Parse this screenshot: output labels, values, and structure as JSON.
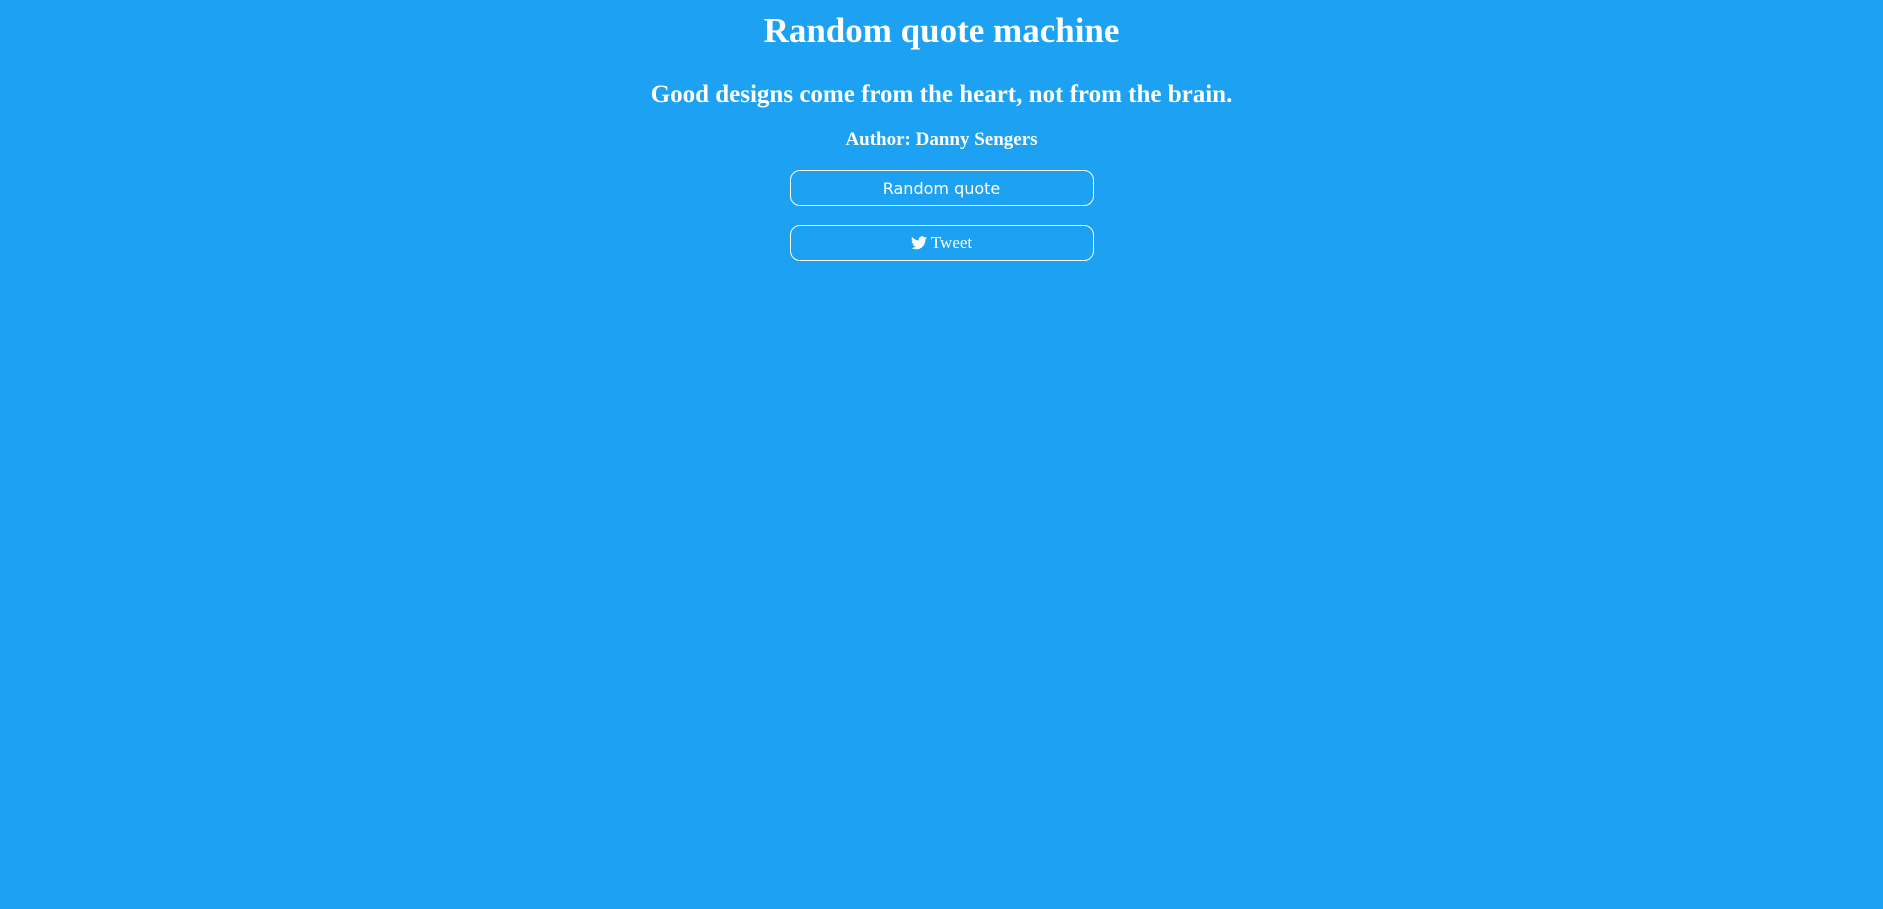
{
  "page": {
    "title": "Random quote machine",
    "background_color": "#1da1f2",
    "text_color": "#ffffff"
  },
  "quote": {
    "text": "Good designs come from the heart, not from the brain.",
    "author": "Author: Danny Sengers"
  },
  "buttons": {
    "random_label": "Random quote",
    "tweet_label": "Tweet",
    "tweet_icon": "twitter-bird-icon"
  }
}
